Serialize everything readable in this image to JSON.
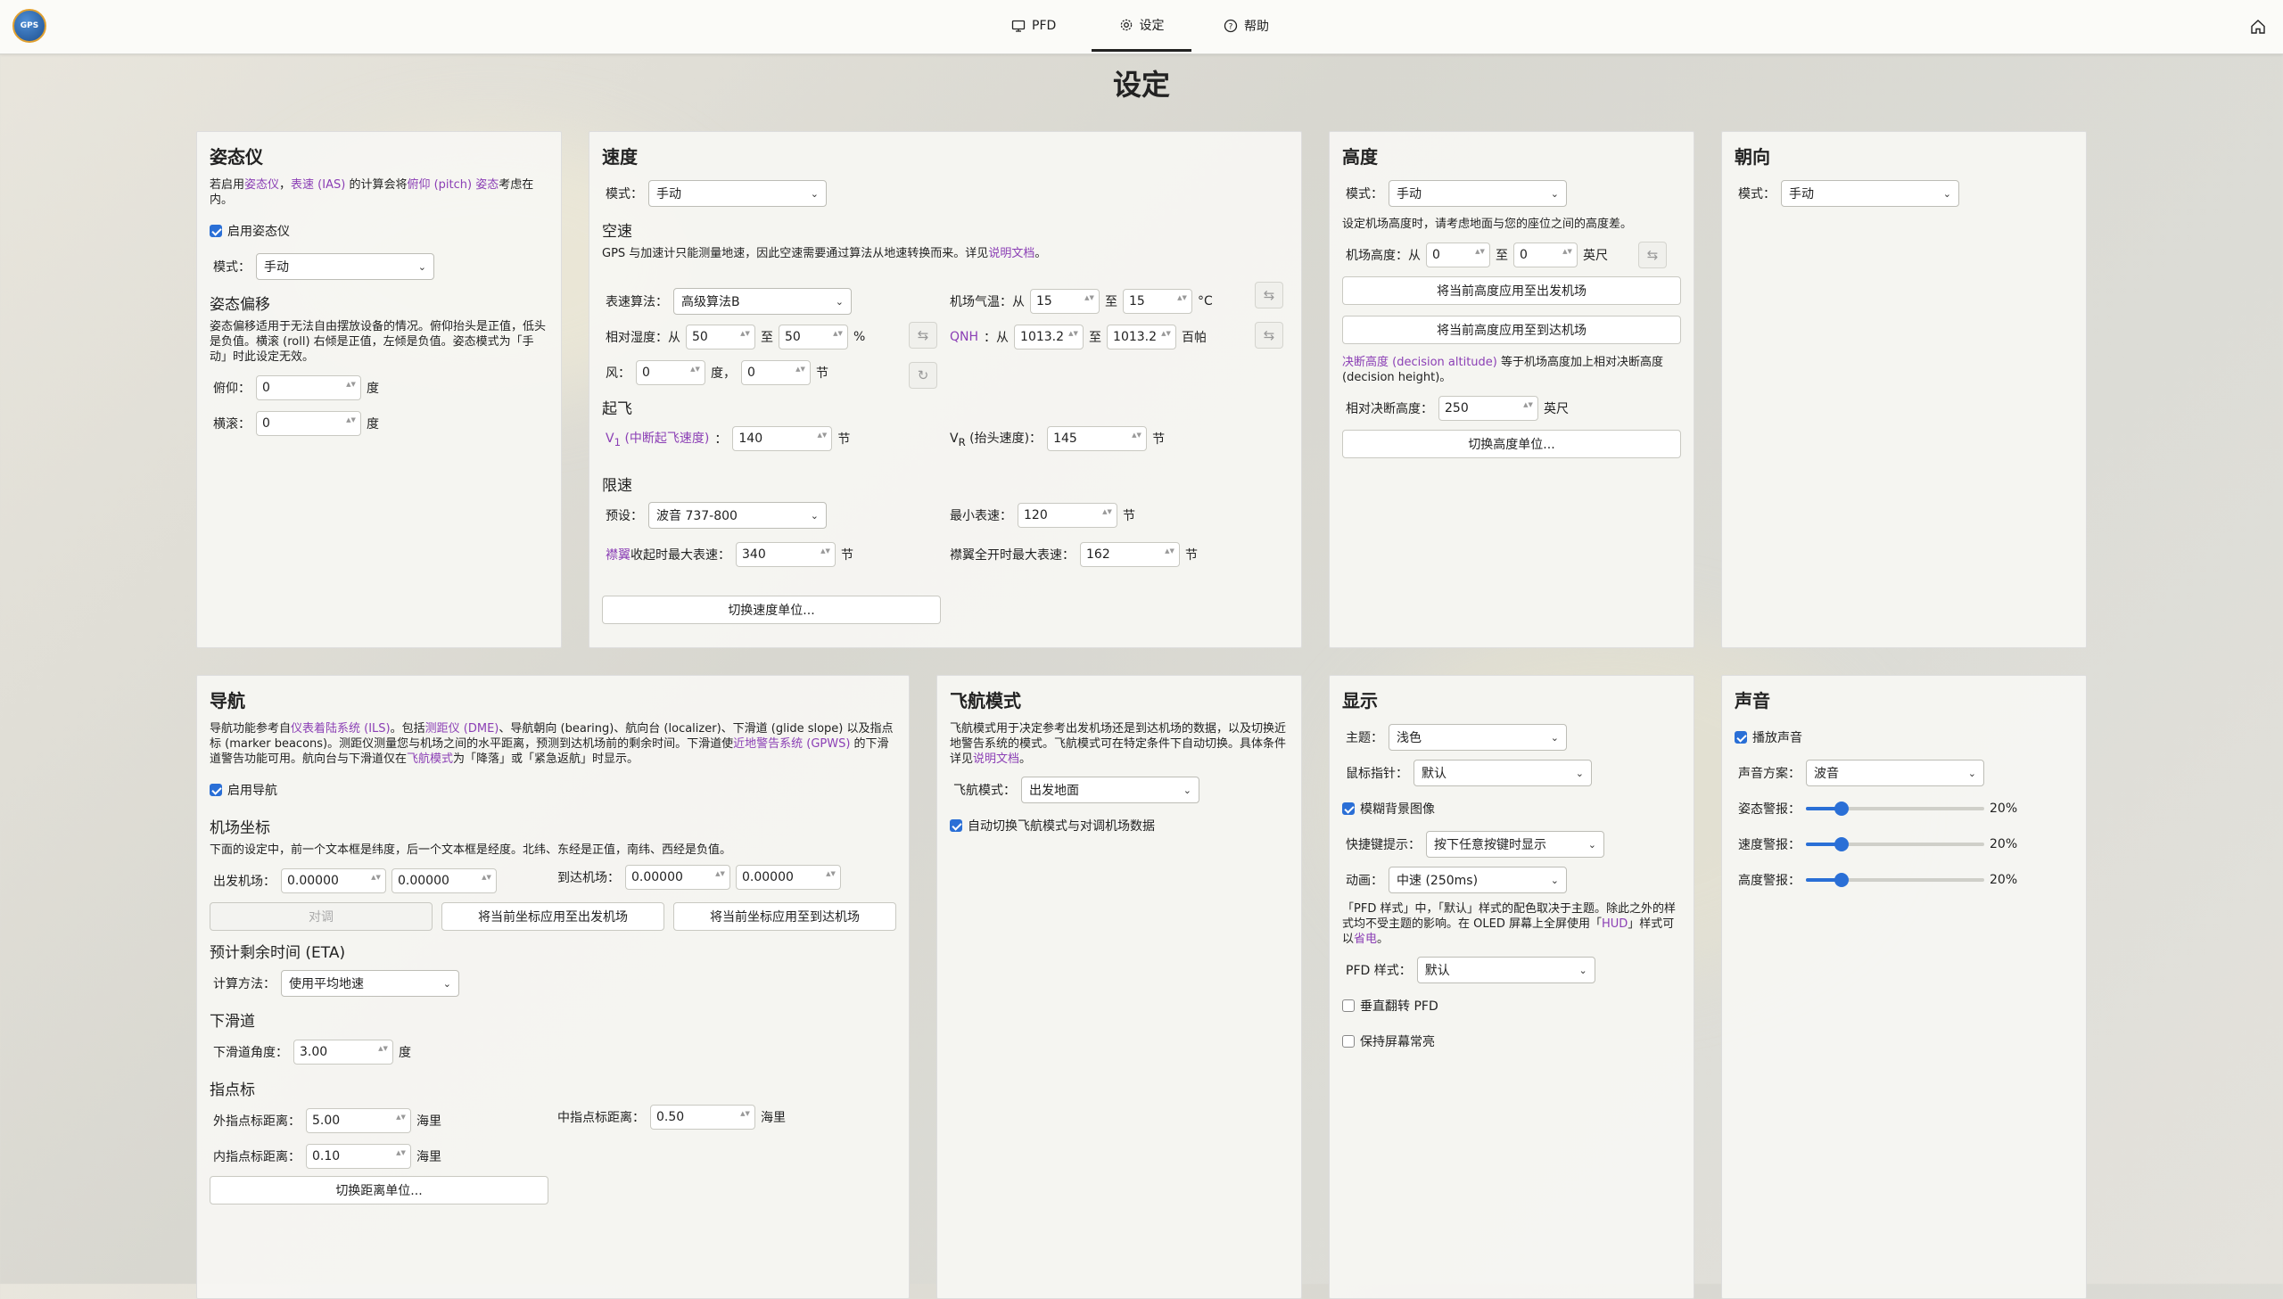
{
  "nav": {
    "logo_text": "GPS",
    "tabs": [
      {
        "label": "PFD",
        "icon": "monitor-icon",
        "active": false
      },
      {
        "label": "设定",
        "icon": "gear-icon",
        "active": true
      },
      {
        "label": "帮助",
        "icon": "help-circle-icon",
        "active": false
      }
    ]
  },
  "page_title": "设定",
  "attitude": {
    "title": "姿态仪",
    "desc_pre": "若启用",
    "desc_link1": "姿态仪",
    "desc_sep": "，",
    "desc_link2": "表速 (IAS)",
    "desc_mid": " 的计算会将",
    "desc_link3": "俯仰 (pitch) 姿态",
    "desc_post": "考虑在内。",
    "enable_label": "启用姿态仪",
    "enable_checked": true,
    "mode_label": "模式：",
    "mode_value": "手动",
    "offset_title": "姿态偏移",
    "offset_desc": "姿态偏移适用于无法自由摆放设备的情况。俯仰抬头是正值，低头是负值。横滚 (roll) 右倾是正值，左倾是负值。姿态模式为「手动」时此设定无效。",
    "pitch_label": "俯仰：",
    "pitch_value": "0",
    "roll_label": "横滚：",
    "roll_value": "0",
    "unit": "度"
  },
  "speed": {
    "title": "速度",
    "mode_label": "模式：",
    "mode_value": "手动",
    "airspeed_title": "空速",
    "airspeed_desc": "GPS 与加速计只能测量地速，因此空速需要通过算法从地速转换而来。详见",
    "airspeed_desc_link": "说明文档",
    "airspeed_desc_end": "。",
    "algo_label": "表速算法：",
    "algo_value": "高级算法B",
    "temp_label": "机场气温：从",
    "temp_from": "15",
    "to": "至",
    "temp_to": "15",
    "temp_unit": "°C",
    "humidity_label": "相对湿度：从",
    "hum_from": "50",
    "hum_to": "50",
    "hum_unit": "%",
    "qnh_label": "QNH",
    "qnh_from_text": "：从",
    "qnh_from": "1013.2",
    "qnh_to": "1013.2",
    "qnh_unit": "百帕",
    "wind_label": "风：",
    "wind_dir": "0",
    "wind_dir_unit": "度，",
    "wind_speed": "0",
    "wind_speed_unit": "节",
    "takeoff_title": "起飞",
    "v1_label": "V",
    "v1_sub": "1",
    "v1_desc": " (中断起飞速度)",
    "colon": "：",
    "v1_value": "140",
    "vr_label": "V",
    "vr_sub": "R",
    "vr_desc": " (抬头速度)：",
    "vr_value": "145",
    "knot": "节",
    "limit_title": "限速",
    "preset_label": "预设：",
    "preset_value": "波音 737-800",
    "min_label": "最小表速：",
    "min_value": "120",
    "flaps_link": "襟翼",
    "flaps_up_label": "收起时最大表速：",
    "flaps_up_value": "340",
    "flaps_full_label": "襟翼全开时最大表速：",
    "flaps_full_value": "162",
    "switch_unit_btn": "切换速度单位..."
  },
  "altitude": {
    "title": "高度",
    "mode_label": "模式：",
    "mode_value": "手动",
    "desc": "设定机场高度时，请考虑地面与您的座位之间的高度差。",
    "elev_label": "机场高度：从",
    "elev_from": "0",
    "to": "至",
    "elev_to": "0",
    "elev_unit": "英尺",
    "apply_dep_btn": "将当前高度应用至出发机场",
    "apply_arr_btn": "将当前高度应用至到达机场",
    "da_link": "决断高度 (decision altitude)",
    "da_desc": " 等于机场高度加上相对决断高度 (decision height)。",
    "dh_label": "相对决断高度：",
    "dh_value": "250",
    "dh_unit": "英尺",
    "switch_unit_btn": "切换高度单位..."
  },
  "heading": {
    "title": "朝向",
    "mode_label": "模式：",
    "mode_value": "手动"
  },
  "navigation": {
    "title": "导航",
    "desc_pre": "导航功能参考自",
    "desc_link1": "仪表着陆系统 (ILS)",
    "desc_mid1": "。包括",
    "desc_link2": "测距仪 (DME)",
    "desc_mid2": "、导航朝向 (bearing)、航向台 (localizer)、下滑道 (glide slope) 以及指点标 (marker beacons)。测距仪测量您与机场之间的水平距离，预测到达机场前的剩余时间。下滑道使",
    "desc_link3": "近地警告系统 (GPWS)",
    "desc_mid3": " 的下滑道警告功能可用。航向台与下滑道仅在",
    "desc_link4": "飞航模式",
    "desc_post": "为「降落」或「紧急返航」时显示。",
    "enable_label": "启用导航",
    "enable_checked": true,
    "coords_title": "机场坐标",
    "coords_desc": "下面的设定中，前一个文本框是纬度，后一个文本框是经度。北纬、东经是正值，南纬、西经是负值。",
    "dep_label": "出发机场：",
    "dep_lat": "0.00000",
    "dep_lon": "0.00000",
    "arr_label": "到达机场：",
    "arr_lat": "0.00000",
    "arr_lon": "0.00000",
    "swap_btn": "对调",
    "apply_dep_btn": "将当前坐标应用至出发机场",
    "apply_arr_btn": "将当前坐标应用至到达机场",
    "eta_title": "预计剩余时间 (ETA)",
    "calc_label": "计算方法：",
    "calc_value": "使用平均地速",
    "glide_title": "下滑道",
    "glide_label": "下滑道角度：",
    "glide_value": "3.00",
    "glide_unit": "度",
    "marker_title": "指点标",
    "outer_label": "外指点标距离：",
    "outer_value": "5.00",
    "middle_label": "中指点标距离：",
    "middle_value": "0.50",
    "inner_label": "内指点标距离：",
    "inner_value": "0.10",
    "nm": "海里",
    "switch_unit_btn": "切换距离单位..."
  },
  "flight_mode": {
    "title": "飞航模式",
    "desc": "飞航模式用于决定参考出发机场还是到达机场的数据，以及切换近地警告系统的模式。飞航模式可在特定条件下自动切换。具体条件详见",
    "desc_link": "说明文档",
    "desc_end": "。",
    "mode_label": "飞航模式：",
    "mode_value": "出发地面",
    "auto_label": "自动切换飞航模式与对调机场数据",
    "auto_checked": true
  },
  "display": {
    "title": "显示",
    "theme_label": "主题：",
    "theme_value": "浅色",
    "cursor_label": "鼠标指针：",
    "cursor_value": "默认",
    "blur_label": "模糊背景图像",
    "blur_checked": true,
    "hotkey_label": "快捷键提示：",
    "hotkey_value": "按下任意按键时显示",
    "anim_label": "动画：",
    "anim_value": "中速 (250ms)",
    "pfd_desc_pre": "「PFD 样式」中，「默认」样式的配色取决于主题。除此之外的样式均不受主题的影响。在 OLED 屏幕上全屏使用「",
    "pfd_desc_link1": "HUD",
    "pfd_desc_mid": "」样式可以",
    "pfd_desc_link2": "省电",
    "pfd_desc_end": "。",
    "pfd_style_label": "PFD 样式：",
    "pfd_style_value": "默认",
    "flip_label": "垂直翻转 PFD",
    "flip_checked": false,
    "keep_awake_label": "保持屏幕常亮",
    "keep_awake_checked": false
  },
  "sound": {
    "title": "声音",
    "play_label": "播放声音",
    "play_checked": true,
    "scheme_label": "声音方案：",
    "scheme_value": "波音",
    "sliders": [
      {
        "label": "姿态警报：",
        "value": 20,
        "text": "20%"
      },
      {
        "label": "速度警报：",
        "value": 20,
        "text": "20%"
      },
      {
        "label": "高度警报：",
        "value": 20,
        "text": "20%"
      }
    ]
  },
  "colors": {
    "accent": "#2a6fd6",
    "link": "#8b3fb5"
  }
}
